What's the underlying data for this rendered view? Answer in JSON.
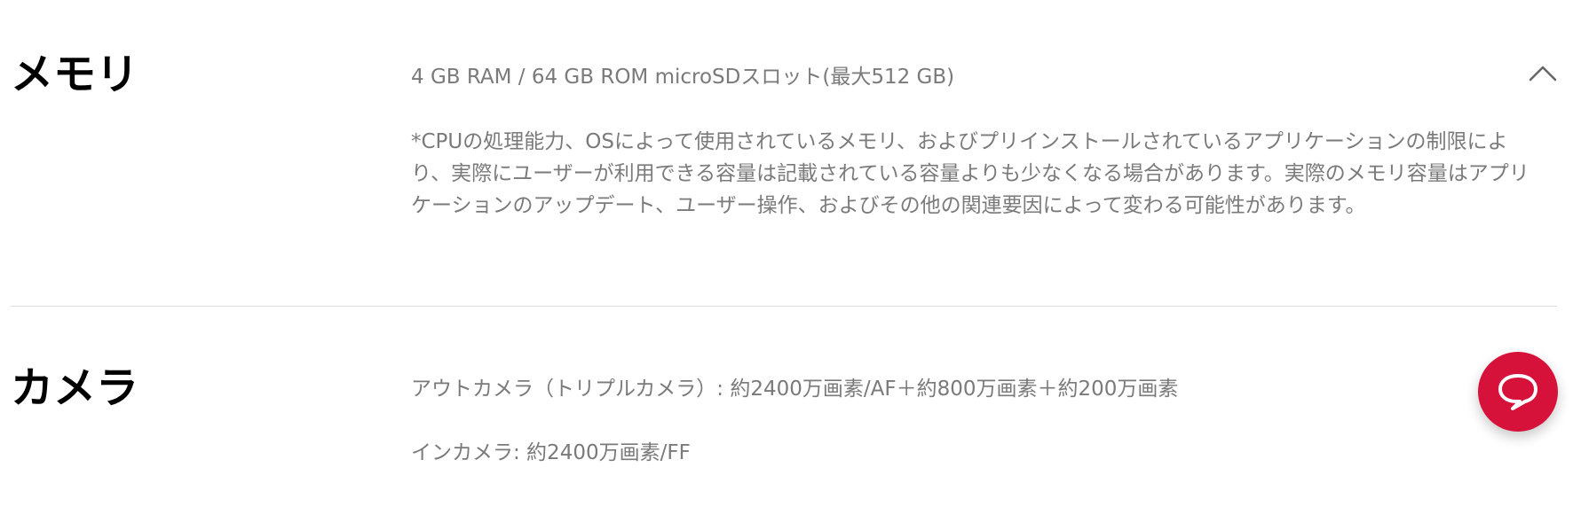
{
  "memory": {
    "title": "メモリ",
    "spec": "4 GB RAM / 64 GB ROM microSDスロット(最大512 GB)",
    "note": "*CPUの処理能力、OSによって使用されているメモリ、およびプリインストールされているアプリケーションの制限により、実際にユーザーが利用できる容量は記載されている容量よりも少なくなる場合があります。実際のメモリ容量はアプリケーションのアップデート、ユーザー操作、およびその他の関連要因によって変わる可能性があります。",
    "toggle_icon": "chevron-up-icon"
  },
  "camera": {
    "title": "カメラ",
    "rear": "アウトカメラ（トリプルカメラ）: 約2400万画素/AF＋約800万画素＋約200万画素",
    "front": "インカメラ: 約2400万画素/FF"
  },
  "chat": {
    "icon": "chat-bubble-icon",
    "color": "#d6113a"
  }
}
